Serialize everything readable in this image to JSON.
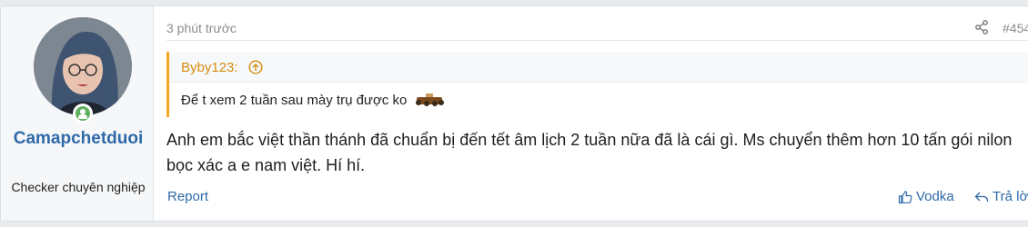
{
  "post": {
    "user": {
      "name": "Camapchetduoi",
      "title": "Checker chuyên nghiệp",
      "avatar_icon": "user-avatar",
      "online_icon": "online-status-icon"
    },
    "time": "3 phút trước",
    "post_number": "#454",
    "quote": {
      "author": "Byby123:",
      "text": "Để t xem 2 tuần sau mày trụ được ko",
      "emoji_icon": "coffin-dance-emoji"
    },
    "message": "Anh em bắc việt thần thánh đã chuẩn bị đến tết âm lịch 2 tuần nữa đã là cái gì. Ms chuyển thêm hơn 10 tấn gói nilon bọc xác a e nam việt. Hí hí.",
    "actions": {
      "report": "Report",
      "like": "Vodka",
      "reply": "Trả lời"
    },
    "colors": {
      "accent": "#2e6aa8",
      "quote_border": "#f5a623",
      "online": "#5fb15f"
    }
  }
}
